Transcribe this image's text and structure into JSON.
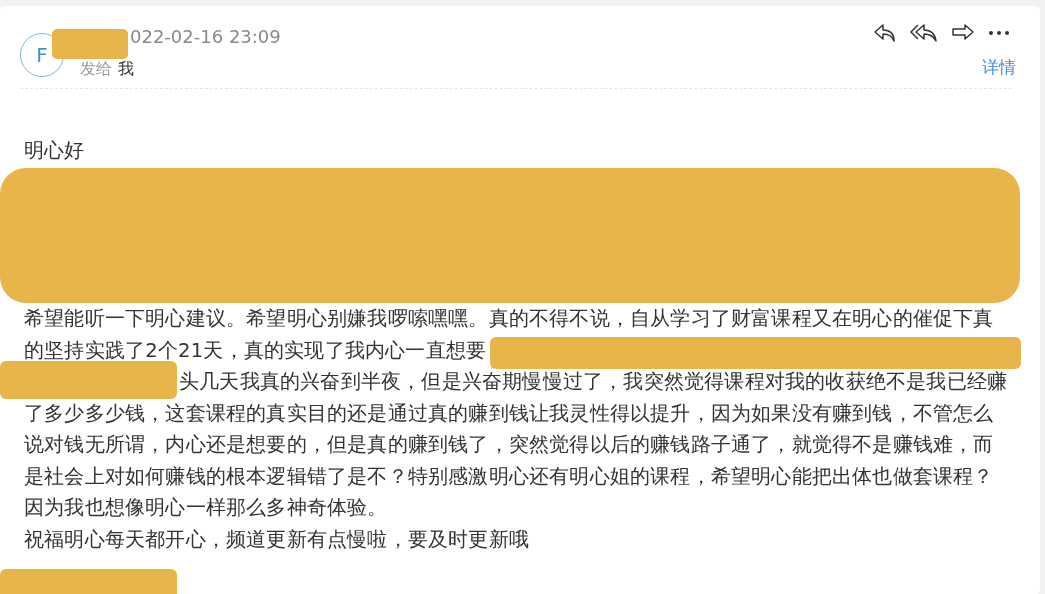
{
  "email": {
    "avatar_letter": "F",
    "date": "022-02-16 23:09",
    "to_label": "发给",
    "recipient": "我",
    "details_link": "详情"
  },
  "body": [
    {
      "kind": "line",
      "text": "明心好",
      "masked_start": false,
      "masked_end": false
    },
    {
      "kind": "redaction"
    },
    {
      "kind": "line",
      "text": "希望能听一下明心建议。希望明心别嫌我啰嗦嘿嘿。真的不得不说，自从学习了财富课程又在明心的催促下真",
      "masked_start": false,
      "masked_end": false
    },
    {
      "kind": "line",
      "text": "的坚持实践了2个21天，真的实现了我内心一直想要",
      "masked_start": false,
      "masked_end": true
    },
    {
      "kind": "line",
      "text": "头几天我真的兴奋到半夜，但是兴奋期慢慢过了，我突然觉得课程对我的收获绝不是我已经赚",
      "masked_start": true,
      "masked_end": false
    },
    {
      "kind": "line",
      "text": "了多少多少钱，这套课程的真实目的还是通过真的赚到钱让我灵性得以提升，因为如果没有赚到钱，不管怎么",
      "masked_start": false,
      "masked_end": false
    },
    {
      "kind": "line",
      "text": "说对钱无所谓，内心还是想要的，但是真的赚到钱了，突然觉得以后的赚钱路子通了，就觉得不是赚钱难，而",
      "masked_start": false,
      "masked_end": false
    },
    {
      "kind": "line",
      "text": "是社会上对如何赚钱的根本逻辑错了是不？特别感激明心还有明心姐的课程，希望明心能把出体也做套课程？",
      "masked_start": false,
      "masked_end": false
    },
    {
      "kind": "line",
      "text": "因为我也想像明心一样那么多神奇体验。",
      "masked_start": false,
      "masked_end": false
    },
    {
      "kind": "line",
      "text": "祝福明心每天都开心，频道更新有点慢啦，要及时更新哦",
      "masked_start": false,
      "masked_end": false
    },
    {
      "kind": "signature"
    }
  ]
}
